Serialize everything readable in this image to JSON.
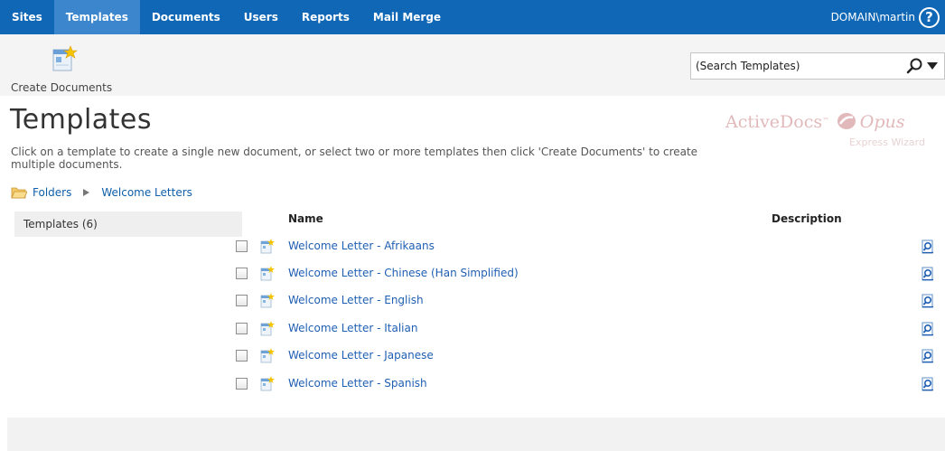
{
  "nav": {
    "items": [
      "Sites",
      "Templates",
      "Documents",
      "Users",
      "Reports",
      "Mail Merge"
    ],
    "active": "Templates",
    "user": "DOMAIN\\martin",
    "help_glyph": "?"
  },
  "toolbar": {
    "create_documents_label": "Create Documents",
    "search_placeholder": "(Search Templates)"
  },
  "page": {
    "title": "Templates",
    "intro": "Click on a template to create a single new document, or select two or more templates then click 'Create Documents' to create multiple documents."
  },
  "brand": {
    "name": "ActiveDocs",
    "tm": "™",
    "product": "Opus",
    "subtitle": "Express Wizard"
  },
  "breadcrumb": {
    "root": "Folders",
    "current": "Welcome Letters"
  },
  "side": {
    "label": "Templates (6)"
  },
  "table": {
    "headers": {
      "name": "Name",
      "description": "Description"
    },
    "rows": [
      {
        "name": "Welcome Letter - Afrikaans",
        "description": ""
      },
      {
        "name": "Welcome Letter - Chinese (Han Simplified)",
        "description": ""
      },
      {
        "name": "Welcome Letter - English",
        "description": ""
      },
      {
        "name": "Welcome Letter - Italian",
        "description": ""
      },
      {
        "name": "Welcome Letter - Japanese",
        "description": ""
      },
      {
        "name": "Welcome Letter - Spanish",
        "description": ""
      }
    ]
  },
  "colors": {
    "nav_bg": "#0f67b6",
    "nav_active": "#3b86cc",
    "link": "#1f5fb3"
  }
}
